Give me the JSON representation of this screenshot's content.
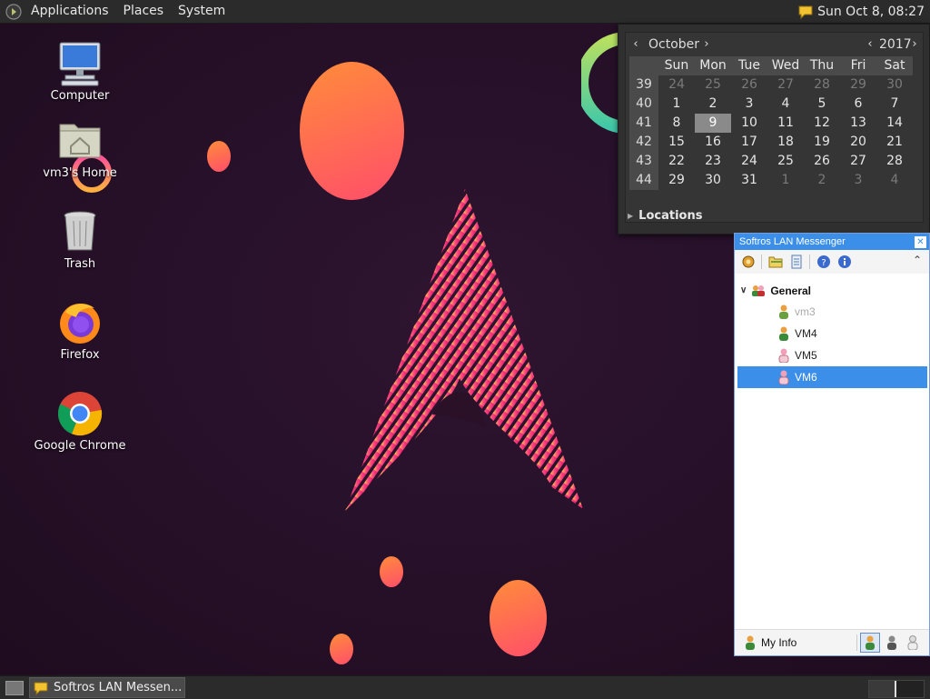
{
  "top_panel": {
    "menus": [
      "Applications",
      "Places",
      "System"
    ],
    "clock": "Sun Oct  8, 08:27"
  },
  "desktop": {
    "icons": [
      {
        "label": "Computer",
        "icon": "computer-icon"
      },
      {
        "label": "vm3's Home",
        "icon": "home-folder-icon"
      },
      {
        "label": "Trash",
        "icon": "trash-icon"
      },
      {
        "label": "Firefox",
        "icon": "firefox-icon"
      },
      {
        "label": "Google Chrome",
        "icon": "chrome-icon"
      }
    ]
  },
  "calendar": {
    "month": "October",
    "year": "2017",
    "weekdays": [
      "Sun",
      "Mon",
      "Tue",
      "Wed",
      "Thu",
      "Fri",
      "Sat"
    ],
    "weeks": [
      {
        "num": "39",
        "days": [
          "24",
          "25",
          "26",
          "27",
          "28",
          "29",
          "30"
        ],
        "out": [
          true,
          true,
          true,
          true,
          true,
          true,
          true
        ]
      },
      {
        "num": "40",
        "days": [
          "1",
          "2",
          "3",
          "4",
          "5",
          "6",
          "7"
        ],
        "out": [
          false,
          false,
          false,
          false,
          false,
          false,
          false
        ]
      },
      {
        "num": "41",
        "days": [
          "8",
          "9",
          "10",
          "11",
          "12",
          "13",
          "14"
        ],
        "out": [
          false,
          false,
          false,
          false,
          false,
          false,
          false
        ]
      },
      {
        "num": "42",
        "days": [
          "15",
          "16",
          "17",
          "18",
          "19",
          "20",
          "21"
        ],
        "out": [
          false,
          false,
          false,
          false,
          false,
          false,
          false
        ]
      },
      {
        "num": "43",
        "days": [
          "22",
          "23",
          "24",
          "25",
          "26",
          "27",
          "28"
        ],
        "out": [
          false,
          false,
          false,
          false,
          false,
          false,
          false
        ]
      },
      {
        "num": "44",
        "days": [
          "29",
          "30",
          "31",
          "1",
          "2",
          "3",
          "4"
        ],
        "out": [
          false,
          false,
          false,
          true,
          true,
          true,
          true
        ]
      }
    ],
    "today": "9",
    "locations_label": "Locations"
  },
  "messenger": {
    "title": "Softros LAN Messenger",
    "group": "General",
    "users": [
      {
        "name": "vm3",
        "state": "offline",
        "color": "#e8a040"
      },
      {
        "name": "VM4",
        "state": "online",
        "color": "#e8a040"
      },
      {
        "name": "VM5",
        "state": "online",
        "color": "#f0a0b8"
      },
      {
        "name": "VM6",
        "state": "selected",
        "color": "#f0a0b8"
      }
    ],
    "my_info_label": "My Info"
  },
  "taskbar": {
    "task_label": "Softros LAN Messen..."
  }
}
